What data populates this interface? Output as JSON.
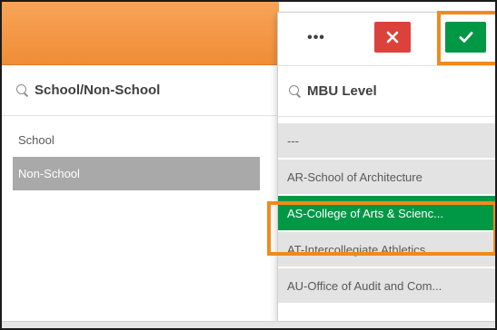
{
  "left_panel": {
    "title": "School/Non-School",
    "items": [
      {
        "label": "School",
        "state": "possible"
      },
      {
        "label": "Non-School",
        "state": "excluded"
      }
    ]
  },
  "right_panel": {
    "title": "MBU Level",
    "toolbar": {
      "more_label": "•••",
      "cancel_icon": "close-icon",
      "confirm_icon": "check-icon"
    },
    "items": [
      {
        "label": "---",
        "state": "possible"
      },
      {
        "label": "AR-School of Architecture",
        "state": "possible"
      },
      {
        "label": "AS-College of Arts & Scienc...",
        "state": "selected"
      },
      {
        "label": "AT-Intercollegiate Athletics",
        "state": "possible"
      },
      {
        "label": "AU-Office of Audit and Com...",
        "state": "possible"
      }
    ]
  },
  "colors": {
    "header_orange": "#f08d37",
    "highlight_orange": "#f08a1c",
    "cancel_red": "#dc423c",
    "confirm_green": "#009845",
    "excluded_grey": "#a9a9a9",
    "possible_grey": "#e3e3e3"
  }
}
